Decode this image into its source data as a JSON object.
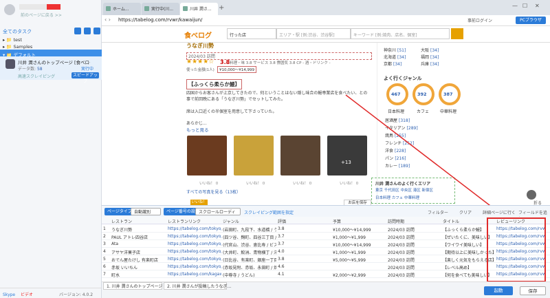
{
  "colors": {
    "accent": "#2b7bd8",
    "highlight": "#e02a2a",
    "brand": "#e67e00"
  },
  "sidebar": {
    "back_link": "前のページに戻る >>",
    "task_header": "全てのタスク",
    "tree": [
      {
        "label": "test"
      },
      {
        "label": "Samples"
      },
      {
        "label": "デフォルト"
      }
    ],
    "task": {
      "title": "川井 潤さんのトップページ [食べログ]ス...",
      "meta_label": "データ数:",
      "meta_value": "58",
      "status": "実行中",
      "schedule": "高速スクレイピング",
      "speed_button": "スピードアップ"
    },
    "footer": {
      "service1": "Skype",
      "service2": "ビデオ",
      "version": "バージョン: 4.0.2"
    }
  },
  "browser": {
    "tabs": [
      {
        "label": "ホーム..."
      },
      {
        "label": "実行中(川..."
      },
      {
        "label": "川井 潤さ..."
      }
    ],
    "new_tab": "+",
    "url": "https://tabelog.com/rvwr/kawaijun/",
    "login": "事前ログイン",
    "pc_button": "PCブラウザ"
  },
  "site": {
    "logo": "食べログ",
    "went_label": "行った店",
    "area_placeholder": "エリア・駅 [例:渋谷、渋谷駅]",
    "keyword_placeholder": "キーワード [例:焼肉、店名、個室]",
    "review_title": "うなぎ川勢",
    "review_date": "2024/03 訪問",
    "stars": "★★★★☆",
    "rating": "3.8",
    "rating_detail": "料理・味 3.8  サービス 3.8  雰囲気 3.8  CP -  酒・ドリンク -",
    "price_label": "使った金額(1人)",
    "price_value": "¥10,000～¥14,999",
    "body_head": "【ふっくら柔らか鰻】",
    "body_p1": "四国からお客さんが上京してきたので、何ということはない隠し味合の鰻専業店を食べたい、との事で前回晩にある「うなぎ川勢」でセットしてみた。",
    "body_p2": "席は入口近くの半個室を用意して下さっていた。",
    "body_p3": "あらかじ...",
    "more": "もっと見る",
    "likes": [
      "いいね！ 0",
      "いいね！ 0",
      "いいね！ 0",
      "いいね！ 0"
    ],
    "photo_badge": "+13",
    "all_photos": "すべての写真を見る（13枚）",
    "fav_button": "いいね！",
    "report_button": "お店を保存"
  },
  "right": {
    "area_rows": [
      [
        "神奈川",
        "51"
      ],
      [
        "大阪",
        "34"
      ],
      [
        "北海道",
        "34"
      ],
      [
        "福岡",
        "34"
      ],
      [
        "京都",
        "34"
      ],
      [
        "兵庫",
        "34"
      ]
    ],
    "genre_head": "よく行くジャンル",
    "donuts": [
      {
        "num": "467",
        "label": "日本料理"
      },
      {
        "num": "392",
        "label": "カフェ"
      },
      {
        "num": "387",
        "label": "中華料理"
      }
    ],
    "genres": [
      [
        "居酒屋",
        "318"
      ],
      [
        "イタリアン",
        "289"
      ],
      [
        "焼鳥",
        "255"
      ],
      [
        "フレンチ",
        "252"
      ],
      [
        "洋食",
        "228"
      ],
      [
        "パン",
        "216"
      ],
      [
        "カレー",
        "189"
      ]
    ],
    "area_box_title": "川井 潤さんのよく行くエリア",
    "area_box_links": "東京 千代田区 中央区 港区 新宿区",
    "area_box_links2": "日本料理 カフェ 中華料理",
    "fold": "折る"
  },
  "panel": {
    "page_type_label": "ページタイプ",
    "page_type_value": "自動識別",
    "page_setting_label": "ページ番号の設定",
    "page_setting_value": "スクロールローディン",
    "loop_link": "スクレイピング範囲を指定",
    "filter": "フィルター",
    "clear": "クリア",
    "detail": "詳細ページに行く",
    "add_field": "フィールドを追加",
    "headers": [
      "",
      "レストラン",
      "レストランリンク",
      "ジャンル",
      "評価",
      "予算",
      "訪問時期",
      "タイトル",
      "レビューリンク"
    ],
    "rows": [
      [
        "1",
        "うなぎ川勢",
        "https://tabelog.com/tokyo/A130...",
        "(岩田町、九段下、水道橋 / う...",
        "3.8",
        "¥10,000～¥14,999",
        "2024/03 訪問",
        "【ふっくら柔らか鰻】",
        "https://tabelog.com/rvwr/kawaij"
      ],
      [
        "2",
        "PAUL アトレ四谷店",
        "https://tabelog.com/tokyo/A130...",
        "(四ツ谷、麹町、四谷三丁目 / ...",
        "3.7",
        "¥1,000～¥1,999",
        "2024/03 訪問",
        "【ぜいたくに、美味しい】",
        "https://tabelog.com/rvwr/kawaij"
      ],
      [
        "3",
        "Ata",
        "https://tabelog.com/tokyo/A130...",
        "(代官山、渋谷、恵比寿 / ビス...",
        "3.7",
        "¥10,000～¥14,999",
        "2024/03 訪問",
        "【ワイワイ美味しい】",
        "https://tabelog.com/rvwr/kawaij"
      ],
      [
        "4",
        "アサヤ洋菓子店",
        "https://tabelog.com/tokyo/A130...",
        "(大井町、鮫洲、青物横丁 / 洋...",
        "4.0",
        "¥1,000～¥1,999",
        "2024/03 訪問",
        "【期待以上に美味しかった】",
        "https://tabelog.com/rvwr/kawaij"
      ],
      [
        "5",
        "おでん屋たけし 有楽町店",
        "https://tabelog.com/tokyo/A130...",
        "(日比谷、有楽町、銀座一丁目 / ...",
        "3.8",
        "¥5,000～¥5,999",
        "2024/03 訪問",
        "【楽しく元気をもらえる店】",
        "https://tabelog.com/rvwr/kawaij"
      ],
      [
        "6",
        "赤坂 いいちん",
        "https://tabelog.com/tokyo/A130...",
        "(赤坂見附、赤坂、永田町 / 焼...",
        "4.6",
        "",
        "2024/03 訪問",
        "【レベル高め】",
        "https://tabelog.com/rvwr/kawaij"
      ],
      [
        "7",
        "町水",
        "https://tabelog.com/kagawa/A3...",
        "(中尊寺 / うどん)",
        "4.1",
        "¥2,000～¥2,999",
        "2024/03 訪問",
        "【何を食べても美味しい】",
        "https://tabelog.com/rvwr/kawaij"
      ]
    ]
  },
  "bottom": {
    "sheets": [
      "1. 川井 潤さんのトップページ [食",
      "2. 川井 潤さんが投稿したうなぎ..."
    ],
    "start": "起動",
    "save": "保存"
  }
}
